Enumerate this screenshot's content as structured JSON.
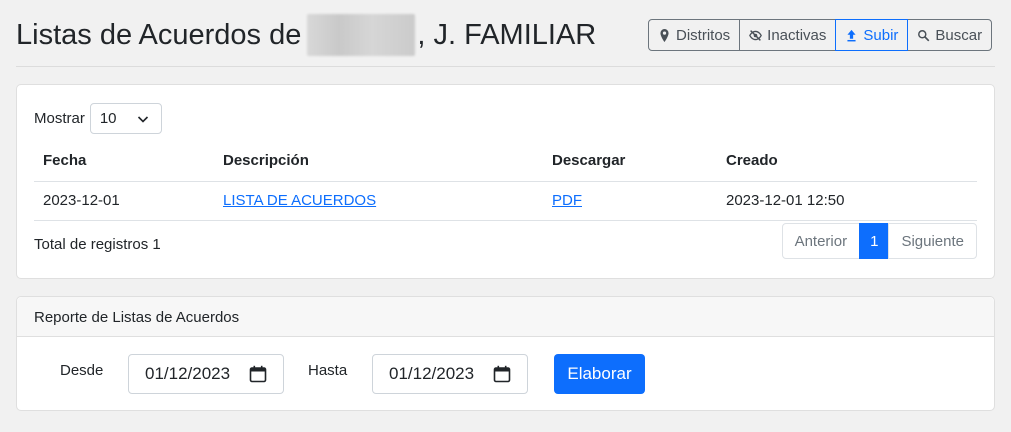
{
  "header": {
    "title_prefix": "Listas de Acuerdos de",
    "title_suffix": ", J. FAMILIAR"
  },
  "toolbar": {
    "distritos_label": "Distritos",
    "inactivas_label": "Inactivas",
    "subir_label": "Subir",
    "buscar_label": "Buscar",
    "active_color": "#0d6efd"
  },
  "list": {
    "mostrar_label": "Mostrar",
    "page_length": "10",
    "columns": [
      "Fecha",
      "Descripción",
      "Descargar",
      "Creado"
    ],
    "rows": [
      {
        "fecha": "2023-12-01",
        "descripcion": "LISTA DE ACUERDOS",
        "descargar": "PDF",
        "creado": "2023-12-01 12:50"
      }
    ],
    "total_label": "Total de registros 1",
    "pagination": {
      "prev": "Anterior",
      "current": "1",
      "next": "Siguiente"
    }
  },
  "report": {
    "title": "Reporte de Listas de Acuerdos",
    "desde_label": "Desde",
    "desde_value": "01/12/2023",
    "hasta_label": "Hasta",
    "hasta_value": "01/12/2023",
    "submit_label": "Elaborar"
  }
}
